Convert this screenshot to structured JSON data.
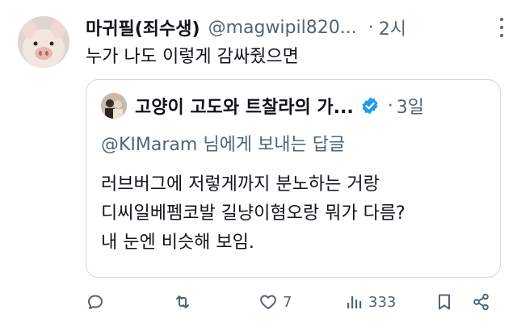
{
  "tweet": {
    "display_name": "마귀필(죄수생)",
    "handle": "@magwipil820...",
    "separator": "·",
    "time": "2시",
    "text": "누가 나도 이렇게 감싸줬으면"
  },
  "quote": {
    "display_name": "고양이 고도와 트찰라의 가...",
    "separator": "·",
    "time": "3일",
    "reply_to": "@KIMaram 님에게 보내는 답글",
    "lines": [
      "러브버그에 저렇게까지 분노하는 거랑",
      "디씨일베펨코발 길냥이혐오랑 뭐가 다름?",
      "내 눈엔 비슷해 보임."
    ]
  },
  "actions": {
    "reply_count": "",
    "retweet_count": "",
    "like_count": "7",
    "view_count": "333"
  },
  "colors": {
    "text": "#0f1419",
    "secondary": "#536471",
    "border": "#cfd9de",
    "verified": "#1d9bf0"
  },
  "icons": [
    "reply-icon",
    "retweet-icon",
    "heart-icon",
    "views-icon",
    "bookmark-icon",
    "share-icon",
    "more-icon",
    "verified-badge-icon"
  ]
}
